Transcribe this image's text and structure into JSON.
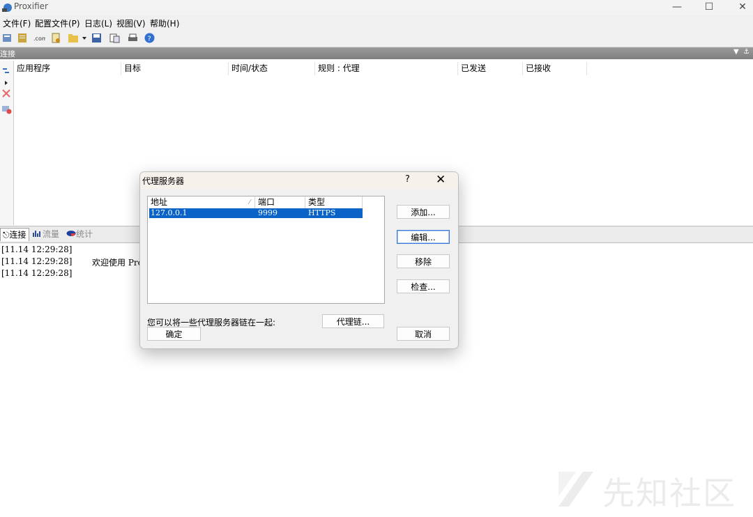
{
  "window": {
    "title": "Proxifier"
  },
  "menu": [
    "文件(F)",
    "配置文件(P)",
    "日志(L)",
    "视图(V)",
    "帮助(H)"
  ],
  "pane": {
    "title": "连接"
  },
  "connections": {
    "columns": [
      "应用程序",
      "目标",
      "时间/状态",
      "规则 : 代理",
      "已发送",
      "已接收"
    ]
  },
  "tabs": [
    {
      "label": "连接",
      "icon": "connections-icon"
    },
    {
      "label": "流量",
      "icon": "traffic-icon"
    },
    {
      "label": "统计",
      "icon": "statistics-icon"
    }
  ],
  "log": [
    {
      "time": "[11.14 12:29:28]",
      "msg": ""
    },
    {
      "time": "[11.14 12:29:28]",
      "msg": "欢迎使用 Pro"
    },
    {
      "time": "[11.14 12:29:28]",
      "msg": ""
    }
  ],
  "dialog": {
    "title": "代理服务器",
    "help": "?",
    "close": "✕",
    "columns": [
      "地址",
      "端口",
      "类型"
    ],
    "rows": [
      {
        "address": "127.0.0.1",
        "port": "9999",
        "type": "HTTPS"
      }
    ],
    "buttons": {
      "add": "添加...",
      "edit": "编辑...",
      "remove": "移除",
      "check": "检查...",
      "chain": "代理链...",
      "ok": "确定",
      "cancel": "取消"
    },
    "chain_text": "您可以将一些代理服务器链在一起:"
  },
  "watermark": "先知社区",
  "colors": {
    "selection": "#0a64c8",
    "pane_header": "#8c8c8c",
    "dialog_title": "#f7f1ec"
  }
}
